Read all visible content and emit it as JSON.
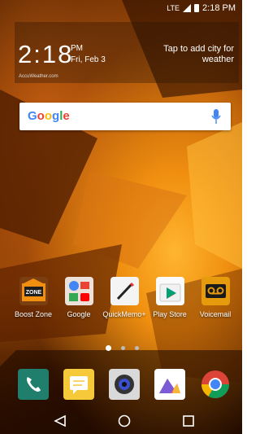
{
  "status": {
    "time": "2:18 PM",
    "network": "LTE"
  },
  "weather": {
    "time": "2:18",
    "ampm": "PM",
    "date": "Fri, Feb 3",
    "cta": "Tap to add city for weather",
    "source": "AccuWeather.com"
  },
  "search": {
    "brand": "Google"
  },
  "apps": [
    {
      "label": "Boost Zone",
      "icon": "boost-zone-icon"
    },
    {
      "label": "Google",
      "icon": "google-apps-folder-icon"
    },
    {
      "label": "QuickMemo+",
      "icon": "quickmemo-icon"
    },
    {
      "label": "Play Store",
      "icon": "play-store-icon"
    },
    {
      "label": "Voicemail",
      "icon": "voicemail-icon"
    }
  ],
  "pages": {
    "count": 3,
    "current": 1
  },
  "dock": [
    {
      "icon": "phone-icon"
    },
    {
      "icon": "messages-icon"
    },
    {
      "icon": "camera-icon"
    },
    {
      "icon": "gallery-icon"
    },
    {
      "icon": "chrome-icon"
    }
  ],
  "colors": {
    "accent": "#f08f10",
    "voicemail": "#e69b0c",
    "phone": "#1f7f6c"
  }
}
